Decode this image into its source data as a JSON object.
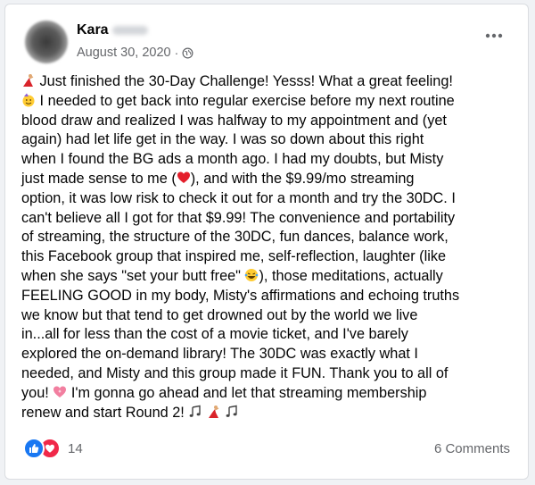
{
  "post": {
    "author_name": "Kara",
    "date": "August 30, 2020",
    "separator": "·",
    "audience_icon": "globe-icon",
    "more_icon": "more-options-icon",
    "lines": [
      "Just finished the 30-Day Challenge! Yesss! What a great feeling!",
      "I needed to get back into regular exercise before my next routine",
      "blood draw and realized I was halfway to my appointment and (yet",
      "again) had let life get in the way. I was so down about this right",
      "when I found the BG ads a month ago. I had my doubts, but Misty",
      "just made sense to me (",
      "), and with the $9.99/mo streaming",
      "option, it was low risk to check it out for a month and try the 30DC. I",
      "can't believe all I got for that $9.99! The convenience and portability",
      "of streaming, the structure of the 30DC, fun dances, balance work,",
      "this Facebook group that inspired me, self-reflection, laughter (like",
      "when she says \"set your butt free\" ",
      "), those meditations, actually",
      "FEELING GOOD in my body, Misty's affirmations and echoing truths",
      "we know but that tend to get drowned out by the world we live",
      "in...all for less than the cost of a movie ticket, and I've barely",
      "explored the on-demand library! The 30DC was exactly what I",
      "needed, and Misty and this group made it FUN. Thank you to all of",
      "you! ",
      " I'm gonna go ahead and let that streaming membership",
      "renew and start Round 2! "
    ]
  },
  "footer": {
    "reaction_icons": [
      "like-reaction-icon",
      "love-reaction-icon"
    ],
    "reaction_count": "14",
    "comments_label": "6 Comments"
  },
  "colors": {
    "like_blue": "#1877f2",
    "love_red": "#f02849",
    "meta_gray": "#65676b"
  }
}
